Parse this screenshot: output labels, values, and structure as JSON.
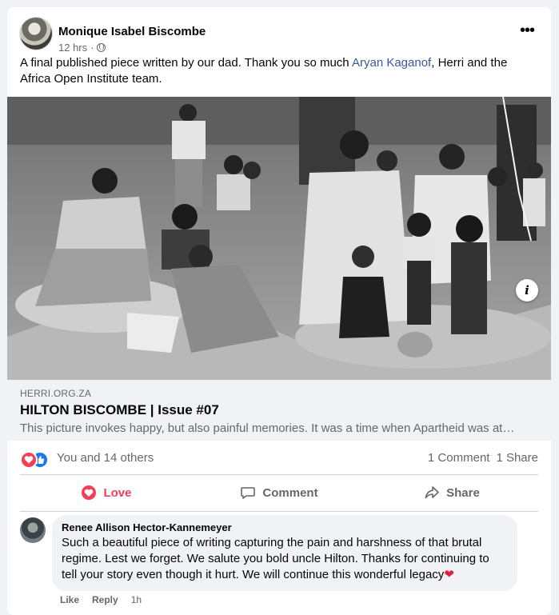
{
  "post": {
    "author": "Monique Isabel Biscombe",
    "time": "12 hrs",
    "separator": "·",
    "more_label": "•••",
    "text_before": "A final published piece written by our dad. Thank you so much ",
    "text_link": "Aryan Kaganof",
    "text_after": ", Herri and the Africa Open Institute team."
  },
  "link_preview": {
    "domain": "HERRI.ORG.ZA",
    "title": "HILTON BISCOMBE | Issue #07",
    "description": "This picture invokes happy, but also painful memories. It was a time when Apartheid was at…",
    "info_label": "i"
  },
  "stats": {
    "reactors": "You and 14 others",
    "comments": "1 Comment",
    "shares": "1 Share"
  },
  "actions": {
    "love": "Love",
    "comment": "Comment",
    "share": "Share"
  },
  "comment": {
    "author": "Renee Allison Hector-Kannemeyer",
    "text": "Such a beautiful piece of writing capturing the pain and harshness of that brutal regime. Lest we forget. We salute you bold uncle Hilton. Thanks for continuing to tell your story even though it hurt. We will continue this wonderful legacy",
    "emoji": "❤",
    "like": "Like",
    "reply": "Reply",
    "time": "1h"
  },
  "colors": {
    "link_blue": "#385898",
    "love_red": "#f33e58",
    "like_blue": "#1877f2",
    "secondary_text": "#65676b",
    "background": "#f0f2f5"
  },
  "icons": [
    "globe-icon",
    "more-icon",
    "info-icon",
    "love-reaction-icon",
    "like-reaction-icon",
    "heart-outline-icon",
    "comment-icon",
    "share-icon"
  ]
}
